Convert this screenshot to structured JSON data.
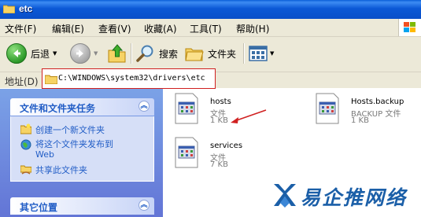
{
  "window": {
    "title": "etc"
  },
  "menu": [
    "文件(F)",
    "编辑(E)",
    "查看(V)",
    "收藏(A)",
    "工具(T)",
    "帮助(H)"
  ],
  "toolbar": {
    "back": "后退",
    "search": "搜索",
    "folders": "文件夹"
  },
  "address": {
    "label": "地址(D)",
    "path": "C:\\WINDOWS\\system32\\drivers\\etc"
  },
  "tasks_panel": {
    "title": "文件和文件夹任务",
    "items": [
      "创建一个新文件夹",
      "将这个文件夹发布到",
      "Web",
      "共享此文件夹"
    ]
  },
  "places_panel": {
    "title": "其它位置"
  },
  "files": [
    {
      "name": "hosts",
      "type": "文件",
      "size": "1 KB"
    },
    {
      "name": "Hosts.backup",
      "type": "BACKUP 文件",
      "size": "1 KB"
    },
    {
      "name": "services",
      "type": "文件",
      "size": "7 KB"
    }
  ],
  "watermark": {
    "text": "易企推网络"
  },
  "colors": {
    "titlebar": "#0a5fd8",
    "task_pane": "#6f8de0",
    "highlight_box": "#d02020",
    "link": "#215dc6"
  }
}
